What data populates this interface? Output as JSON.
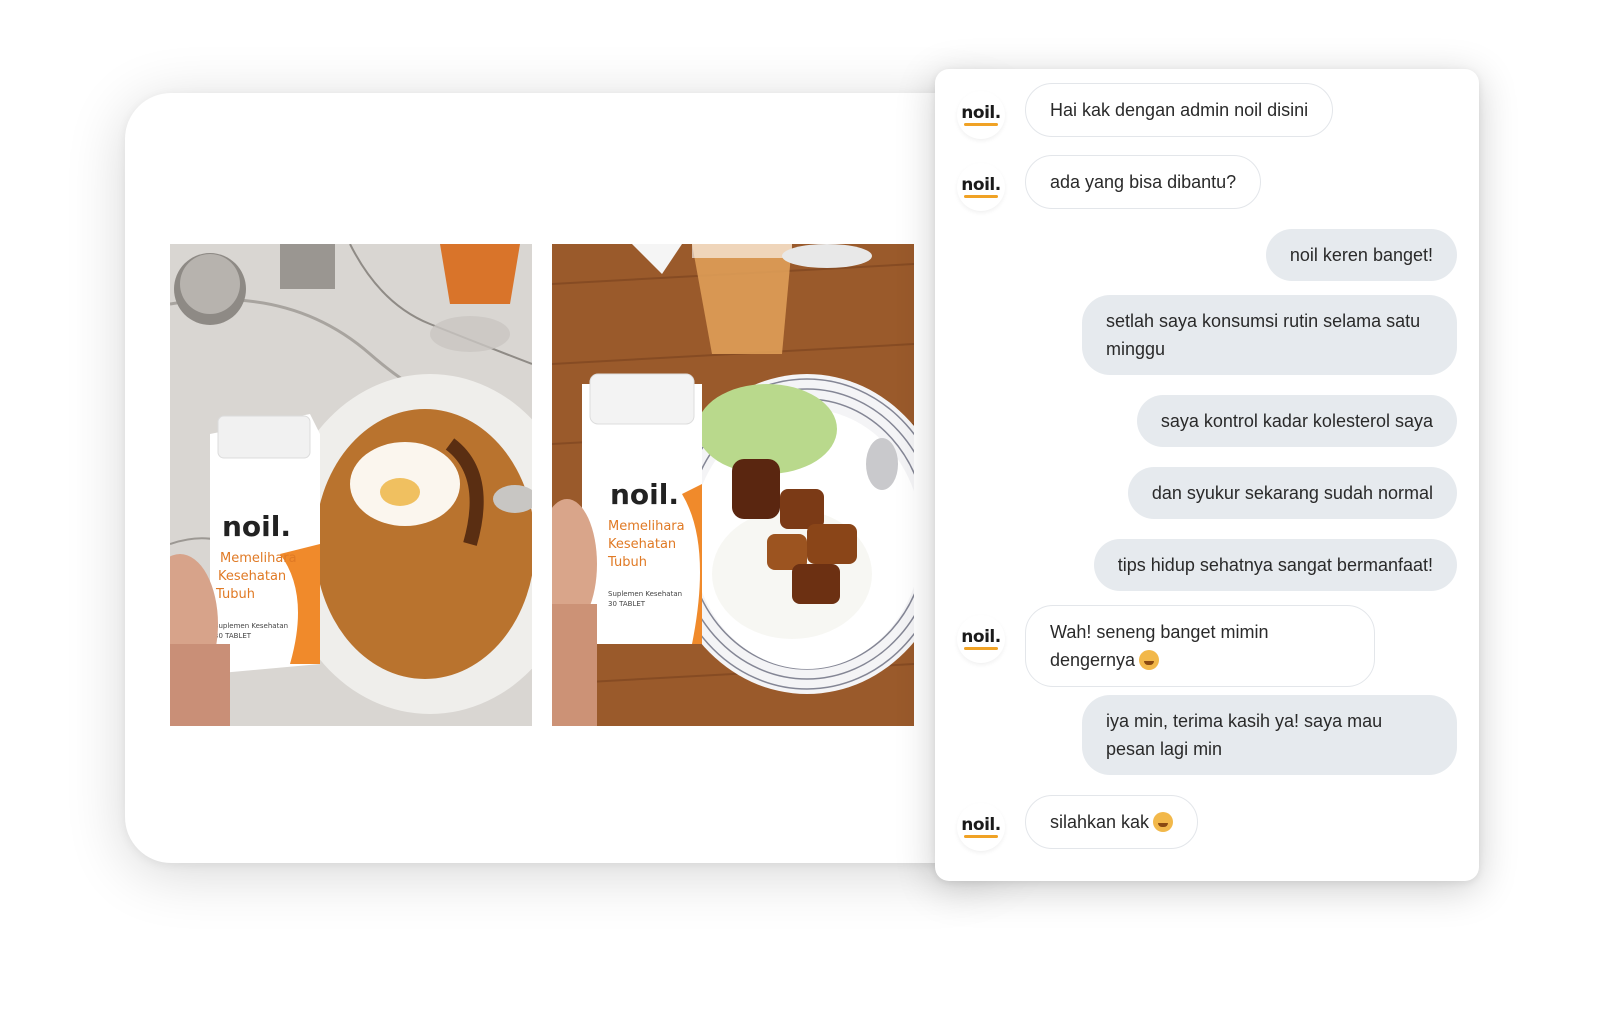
{
  "brand": {
    "logo_text": "noil.",
    "accent": "#f0a225"
  },
  "photos": [
    {
      "bottle_brand": "noil.",
      "bottle_line1": "Memelihara",
      "bottle_line2": "Kesehatan",
      "bottle_line3": "Tubuh",
      "bottle_sub": "Suplemen Kesehatan",
      "bottle_count": "30 TABLET"
    },
    {
      "bottle_brand": "noil.",
      "bottle_line1": "Memelihara",
      "bottle_line2": "Kesehatan",
      "bottle_line3": "Tubuh",
      "bottle_sub": "Suplemen Kesehatan",
      "bottle_count": "30 TABLET"
    }
  ],
  "chat": {
    "messages": [
      {
        "from": "admin",
        "text": "Hai kak dengan admin noil disini"
      },
      {
        "from": "admin",
        "text": "ada yang bisa dibantu?"
      },
      {
        "from": "user",
        "text": "noil keren banget!"
      },
      {
        "from": "user",
        "text": "setlah saya konsumsi rutin selama satu minggu"
      },
      {
        "from": "user",
        "text": "saya kontrol kadar kolesterol saya"
      },
      {
        "from": "user",
        "text": "dan syukur sekarang sudah normal"
      },
      {
        "from": "user",
        "text": "tips hidup sehatnya sangat bermanfaat!"
      },
      {
        "from": "admin",
        "text": "Wah! seneng banget mimin dengernya"
      },
      {
        "from": "user",
        "text": "iya min, terima kasih ya! saya mau pesan lagi min"
      },
      {
        "from": "admin",
        "text": "silahkan kak"
      }
    ],
    "emoji": "grinning-face-emoji"
  }
}
